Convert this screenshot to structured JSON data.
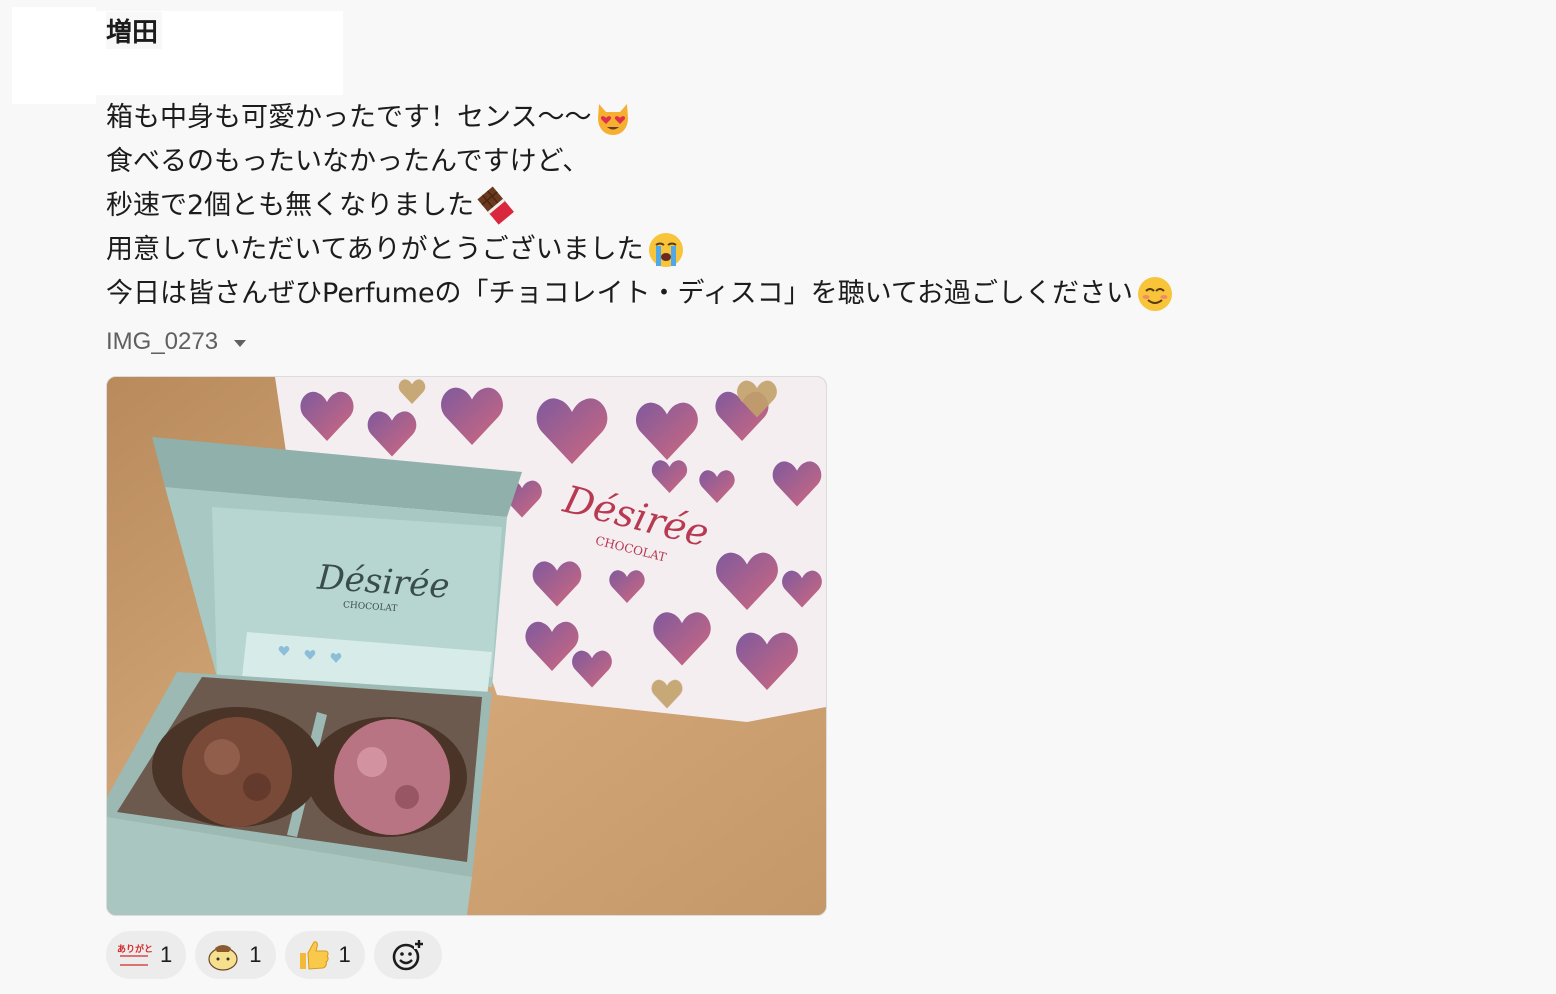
{
  "message": {
    "author": "増田",
    "lines": [
      {
        "text": "箱も中身も可愛かったです！センス〜〜",
        "emoji": "heart-eyes-cat-icon"
      },
      {
        "text": "食べるのもったいなかったんですけど、",
        "emoji": ""
      },
      {
        "text": "秒速で2個とも無くなりました",
        "emoji": "chocolate-bar-icon"
      },
      {
        "text": "用意していただいてありがとうございました",
        "emoji": "crying-face-icon"
      },
      {
        "text": "今日は皆さんぜひPerfumeの「チョコレイト・ディスコ」を聴いてお過ごしください",
        "emoji": "smiling-face-icon"
      }
    ]
  },
  "attachment": {
    "file_name": "IMG_0273",
    "box_brand": "Désirée",
    "box_sub": "CHOCOLAT",
    "bag_brand": "Désirée",
    "bag_sub": "CHOCOLAT"
  },
  "reactions": [
    {
      "icon": "arigatou-gozaimasu-icon",
      "label": "ありがとうございます!",
      "count": "1"
    },
    {
      "icon": "pompompurin-icon",
      "count": "1"
    },
    {
      "icon": "thumbs-up-icon",
      "count": "1"
    }
  ],
  "colors": {
    "background": "#f8f8f8",
    "text": "#1d1c1d",
    "muted": "#616061",
    "reaction_bg": "#ececec"
  }
}
